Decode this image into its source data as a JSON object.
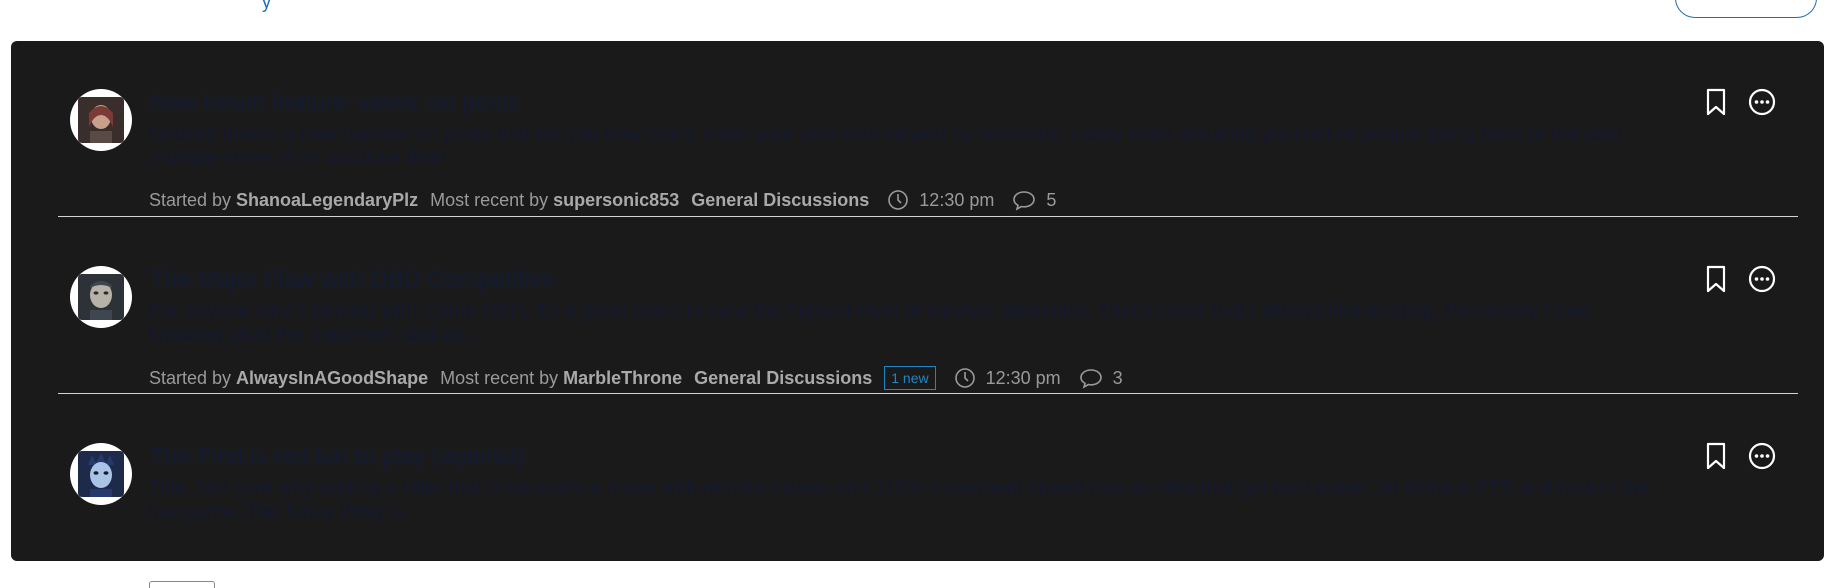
{
  "header": {
    "fragment_text": "y"
  },
  "discussions": [
    {
      "title": "New forum feature 'views' on posts",
      "excerpt": "Noticed theres a new number on posts that tell you how many times your post was viewed by someone. Likely even including yourself or people going back to the post multiple times. If its accurate than ...",
      "started_label": "Started by",
      "author": "ShanoaLegendaryPlz",
      "recent_label": "Most recent by",
      "recent_author": "supersonic853",
      "category": "General Discussions",
      "time": "12:30 pm",
      "comments": "5",
      "avatar_colors": [
        "#7a3b36",
        "#c9a18a"
      ]
    },
    {
      "title": "The Major Flaw with DBD Competitive",
      "excerpt": "For anyone who's familiar with Comp DBD, it's a great place to view the highest level of survivor gameplay. That's some that I always find exciting. Personally I love knowing what the maximum skill-ca...",
      "started_label": "Started by",
      "author": "AlwaysInAGoodShape",
      "recent_label": "Most recent by",
      "recent_author": "MarbleThrone",
      "category": "General Discussions",
      "badge": "1 new",
      "time": "12:30 pm",
      "comments": "3",
      "avatar_colors": [
        "#3e4650",
        "#b7b2a8"
      ]
    },
    {
      "title": "The First is not fun to play (against)",
      "excerpt": "Title. Not sure why adding a killer that is basically a nurse with remote injures and 110% movement speed was an idea that got past paper, let alone a PTB and now in the live game. The funny thing is ...",
      "avatar_colors": [
        "#27386a",
        "#a9c4e6"
      ]
    }
  ],
  "icons": {
    "bookmark": "bookmark-icon",
    "more": "more-options-icon",
    "clock": "clock-icon",
    "comment": "comment-icon"
  },
  "colors": {
    "panel_bg": "#1a1a1b",
    "title": "#131a33",
    "meta_text": "#9a9a9a",
    "badge": "#1b87c7",
    "accent": "#1b6fb5"
  }
}
